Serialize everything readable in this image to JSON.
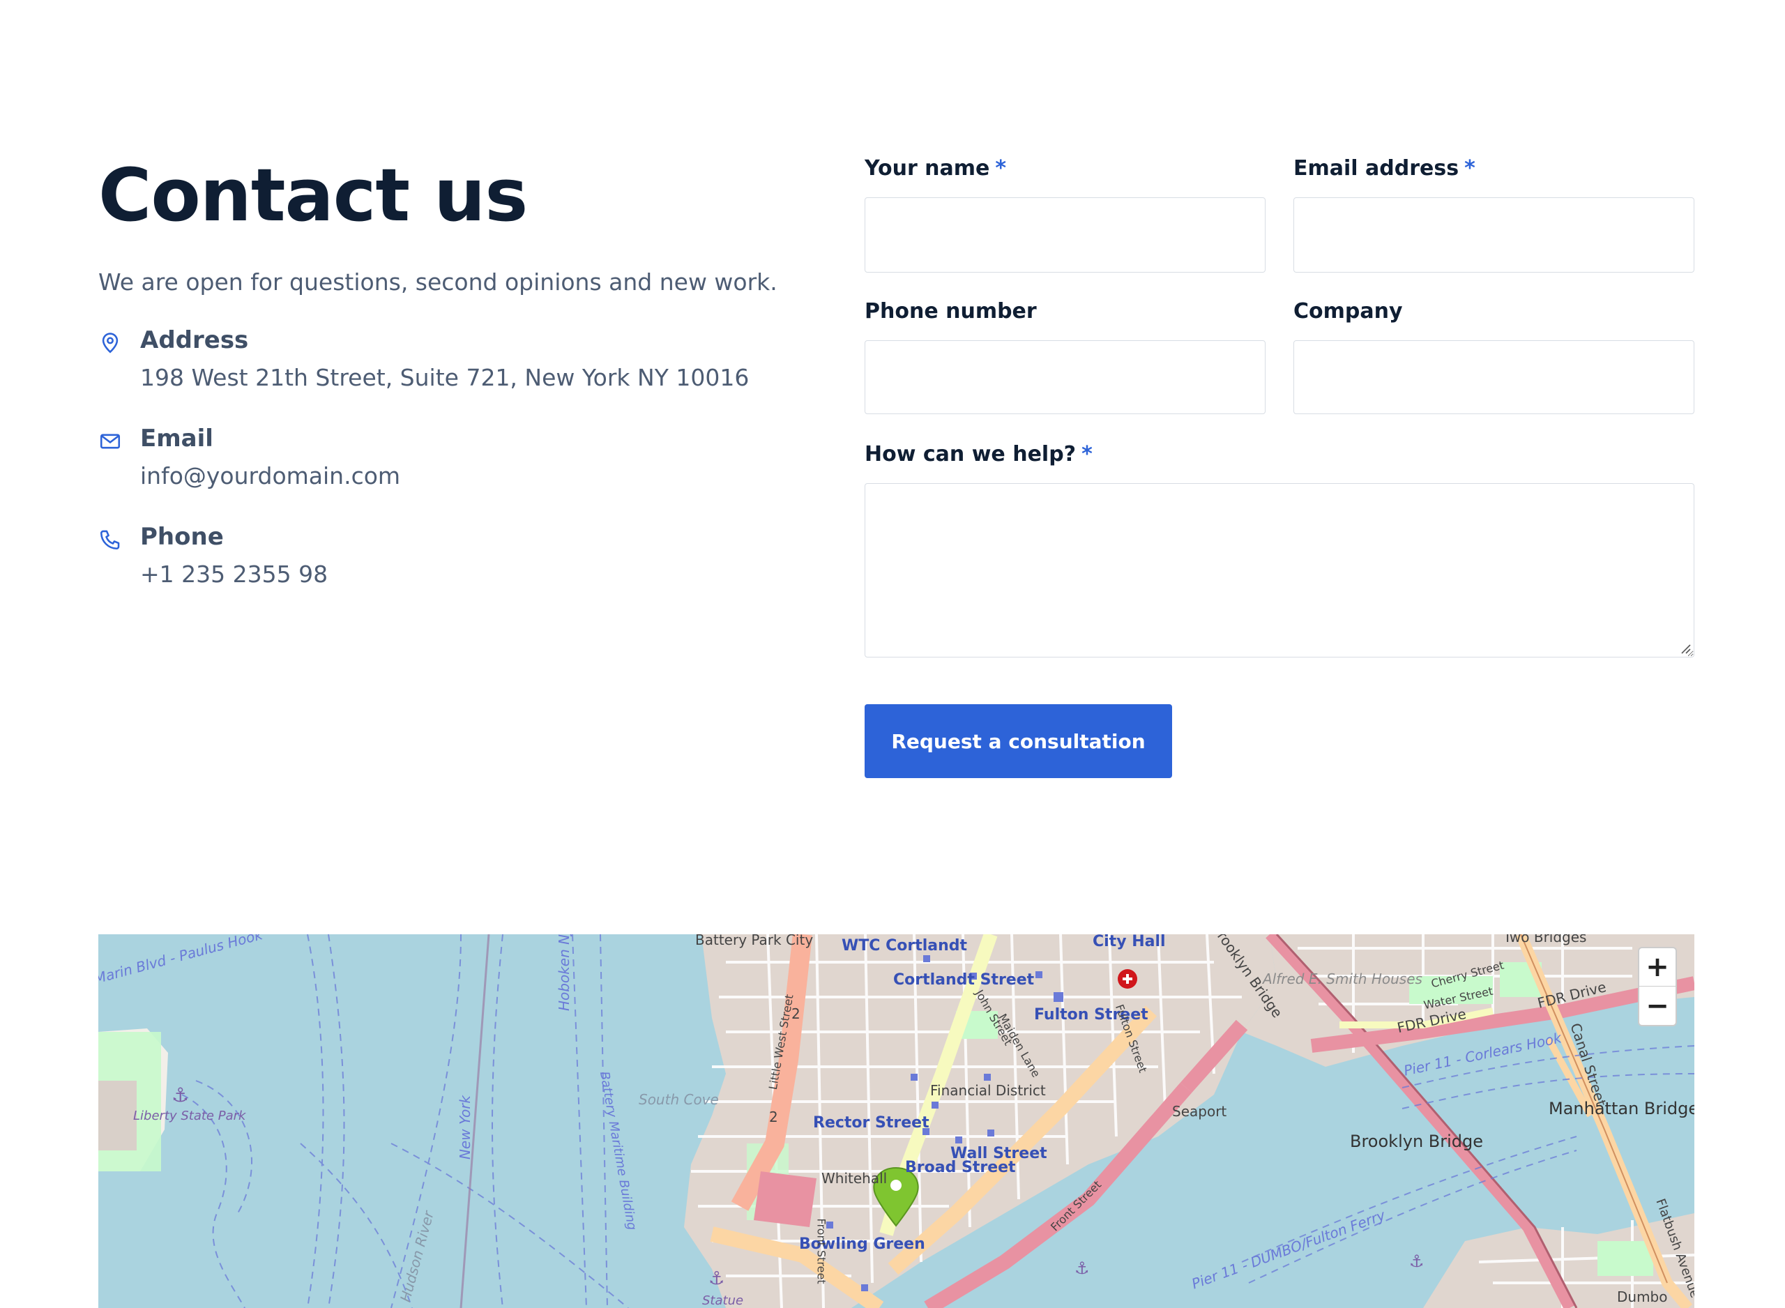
{
  "contact": {
    "title": "Contact us",
    "lead": "We are open for questions, second opinions and new work.",
    "items": [
      {
        "icon": "map-pin-icon",
        "label": "Address",
        "value": "198 West 21th Street, Suite 721, New York NY 10016"
      },
      {
        "icon": "mail-icon",
        "label": "Email",
        "value": "info@yourdomain.com"
      },
      {
        "icon": "phone-icon",
        "label": "Phone",
        "value": "+1 235 2355 98"
      }
    ]
  },
  "form": {
    "name_label": "Your name",
    "email_label": "Email address",
    "phone_label": "Phone number",
    "company_label": "Company",
    "help_label": "How can we help?",
    "required_mark": "*",
    "name_value": "",
    "email_value": "",
    "phone_value": "",
    "company_value": "",
    "help_value": "",
    "submit_label": "Request a consultation"
  },
  "map": {
    "zoom_in": "+",
    "zoom_out": "−",
    "labels": {
      "battery_park_city": "Battery Park City",
      "wtc_cortlandt": "WTC Cortlandt",
      "city_hall": "City Hall",
      "brooklyn_bridge_road": "Brooklyn Bridge",
      "two_bridges": "Two Bridges",
      "cortlandt_street": "Cortlandt Street",
      "fulton_street": "Fulton Street",
      "alfred_smith": "Alfred E. Smith Houses",
      "cherry_street": "Cherry Street",
      "water_street": "Water Street",
      "fdr_drive": "FDR Drive",
      "canal_street": "Canal Street",
      "financial_district": "Financial District",
      "south_cove": "South Cove",
      "seaport": "Seaport",
      "rector_street": "Rector Street",
      "wall_street": "Wall Street",
      "broad_street": "Broad Street",
      "whitehall": "Whitehall",
      "bowling_green": "Bowling Green",
      "liberty_state_park": "Liberty State Park",
      "marin_blvd": "Marin Blvd - Paulus Hook",
      "hoboken_nj": "Hoboken NJ",
      "new_york": "New York",
      "hudson_river": "Hudson River",
      "battery_maritime": "Battery Maritime Building",
      "brooklyn_bridge_label": "Brooklyn Bridge",
      "manhattan_bridge": "Manhattan Bridge",
      "pier_11_corlears": "Pier 11 - Corlears Hook",
      "pier_11_dumbo": "Pier 11 - DUMBO/Fulton Ferry",
      "front_street": "Front Street",
      "flatbush_avenue": "Flatbush Avenue",
      "dumbo": "Dumbo",
      "statue": "Statue",
      "little_west_street": "Little West Street",
      "john_street": "John Street",
      "maiden_lane": "Maiden Lane",
      "fulton_street_road": "Fulton Street",
      "route_2": "2"
    },
    "colors": {
      "water": "#aad3df",
      "land": "#f2efe9",
      "urban": "#e0d6cf",
      "park": "#c8facc",
      "primary_road": "#fcd6a4",
      "motorway": "#e892a2",
      "trunk": "#f9b29c",
      "secondary_road": "#f7fabf",
      "marker": "#7fc530"
    }
  }
}
